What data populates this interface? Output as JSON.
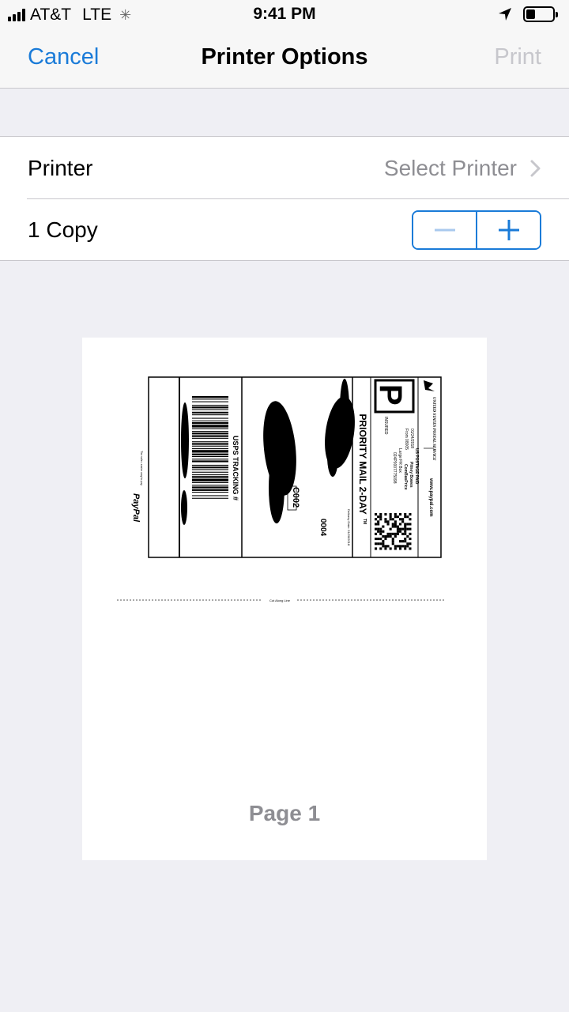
{
  "status_bar": {
    "carrier": "AT&T",
    "network": "LTE",
    "time": "9:41 PM",
    "battery_level": 0.35
  },
  "nav": {
    "cancel_label": "Cancel",
    "title": "Printer Options",
    "print_label": "Print"
  },
  "printer_row": {
    "label": "Printer",
    "value": "Select Printer"
  },
  "copies_row": {
    "label": "1 Copy"
  },
  "preview": {
    "page_label": "Page 1",
    "label": {
      "service_banner": "PRIORITY MAIL 2-DAY",
      "trademark": "TM",
      "tracking_label": "USPS TRACKING #",
      "postage_paid": "US POSTAGE PAID",
      "date": "01/24/2018",
      "from_zip": "From 08005",
      "service_detail": "Large FR Box",
      "commercial": "ComBasPrice",
      "pitney": "Pitney Bowes",
      "id_number": "024P0007775098",
      "insured": "INSURED",
      "website": "www.paypal.com",
      "usps_name": "UNITED STATES POSTAL SERVICE",
      "code_c": "C002",
      "code_num": "0004",
      "delivery_date": "Delivery Date: 01/26/2018",
      "postage_letter": "P",
      "brand": "PayPal",
      "footer_small": "The safer, easier way to pay",
      "cut_line": "Cut Along Line"
    }
  },
  "colors": {
    "accent": "#1a7bd8",
    "disabled": "#c7c7cc",
    "secondary_text": "#8e8e93",
    "background": "#efeff4"
  }
}
